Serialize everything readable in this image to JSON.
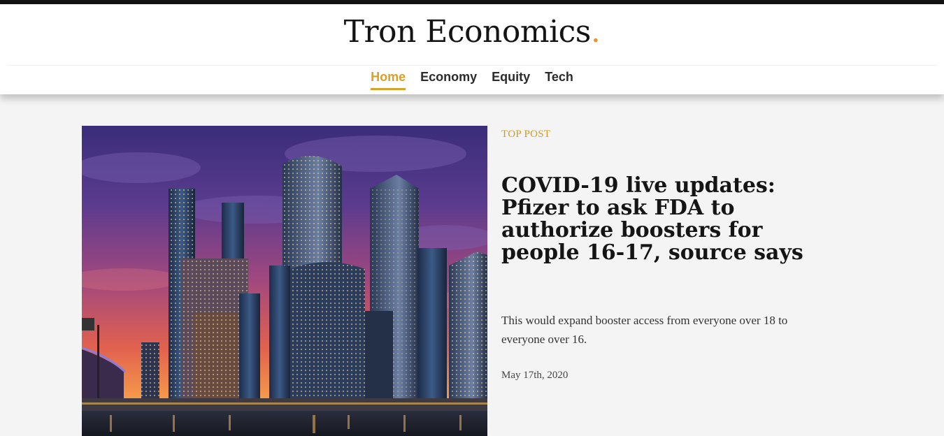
{
  "brand": {
    "name": "Tron Economics",
    "dot": ".",
    "accent_color": "#e8962a"
  },
  "nav": {
    "items": [
      {
        "label": "Home",
        "active": true
      },
      {
        "label": "Economy",
        "active": false
      },
      {
        "label": "Equity",
        "active": false
      },
      {
        "label": "Tech",
        "active": false
      }
    ],
    "active_color": "#d8a128"
  },
  "post": {
    "kicker": "TOP POST",
    "headline": "COVID-19 live updates: Pfizer to ask FDA to authorize boosters for people 16-17, source says",
    "summary": "This would expand booster access from everyone over 18 to everyone over 16.",
    "date": "May 17th, 2020",
    "image_icon": "city-skyline-photo"
  }
}
